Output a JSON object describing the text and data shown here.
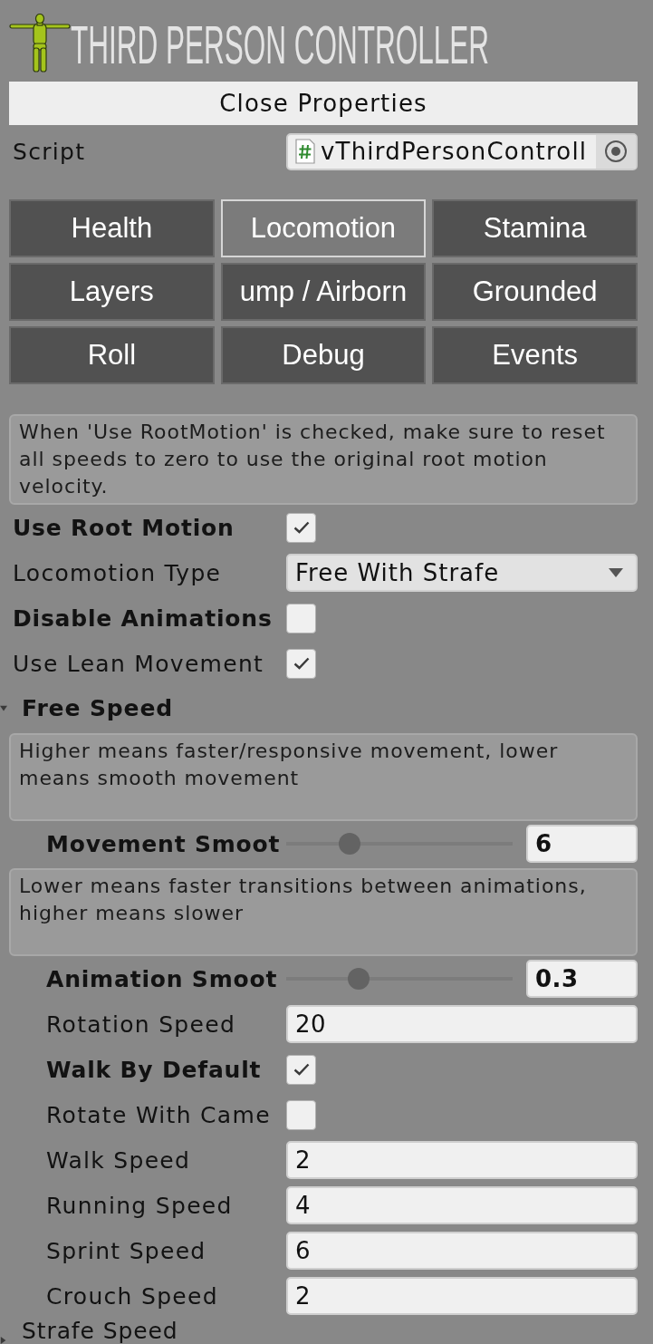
{
  "header": {
    "title": "THIRD PERSON CONTROLLER",
    "close_button": "Close Properties"
  },
  "script": {
    "label": "Script",
    "value": "vThirdPersonControll"
  },
  "tabs": [
    {
      "label": "Health",
      "selected": false
    },
    {
      "label": "Locomotion",
      "selected": true
    },
    {
      "label": "Stamina",
      "selected": false
    },
    {
      "label": "Layers",
      "selected": false
    },
    {
      "label": "ump / Airborn",
      "selected": false
    },
    {
      "label": "Grounded",
      "selected": false
    },
    {
      "label": "Roll",
      "selected": false
    },
    {
      "label": "Debug",
      "selected": false
    },
    {
      "label": "Events",
      "selected": false
    }
  ],
  "help_message": "When 'Use RootMotion' is checked, make sure to reset all speeds to zero to use the original root motion velocity.",
  "properties": [
    {
      "kind": "checkbox",
      "label": "Use Root Motion",
      "modified": true,
      "checked": true
    },
    {
      "kind": "dropdown",
      "label": "Locomotion Type",
      "modified": false,
      "value": "Free With Strafe"
    },
    {
      "kind": "checkbox",
      "label": "Disable Animations",
      "modified": true,
      "checked": false
    },
    {
      "kind": "checkbox",
      "label": "Use Lean Movement",
      "modified": false,
      "checked": true
    }
  ],
  "sections": [
    {
      "title": "Free Speed",
      "modified": true,
      "expanded": true,
      "items": [
        {
          "kind": "help",
          "text": "Higher means faster/responsive movement, lower means smooth movement"
        },
        {
          "kind": "slider",
          "label": "Movement Smoot",
          "modified": true,
          "level": 0.28,
          "value": "6"
        },
        {
          "kind": "help",
          "text": "Lower means faster transitions between animations, higher means slower"
        },
        {
          "kind": "slider",
          "label": "Animation Smoot",
          "modified": true,
          "level": 0.32,
          "value": "0.3"
        },
        {
          "kind": "number",
          "label": "Rotation Speed",
          "modified": false,
          "value": "20"
        },
        {
          "kind": "checkbox",
          "label": "Walk By Default",
          "modified": true,
          "checked": true
        },
        {
          "kind": "checkbox",
          "label": "Rotate With Came",
          "modified": false,
          "checked": false
        },
        {
          "kind": "number",
          "label": "Walk Speed",
          "modified": false,
          "value": "2"
        },
        {
          "kind": "number",
          "label": "Running Speed",
          "modified": false,
          "value": "4"
        },
        {
          "kind": "number",
          "label": "Sprint Speed",
          "modified": false,
          "value": "6"
        },
        {
          "kind": "number",
          "label": "Crouch Speed",
          "modified": false,
          "value": "2"
        }
      ]
    },
    {
      "title": "Strafe Speed",
      "modified": false,
      "expanded": false
    }
  ]
}
